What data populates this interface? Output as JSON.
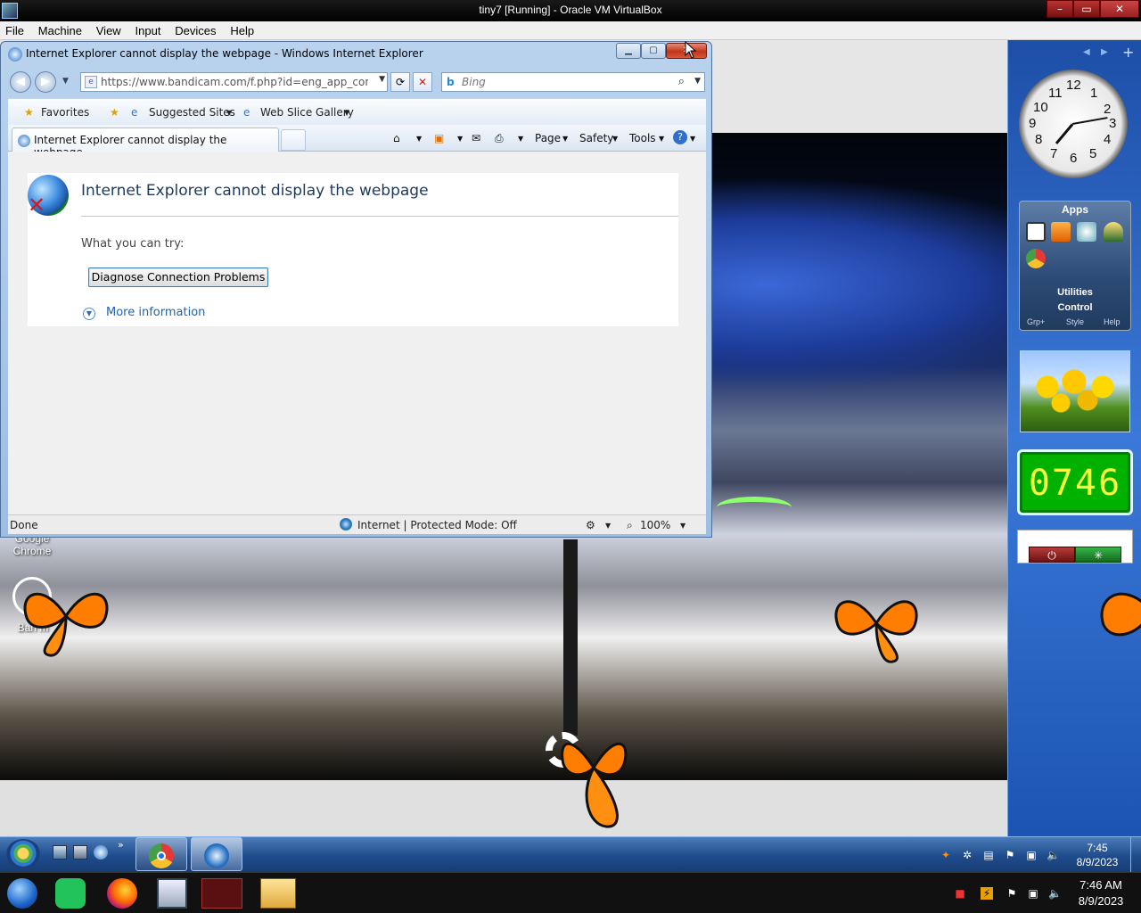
{
  "host": {
    "title": "tiny7 [Running] - Oracle VM VirtualBox",
    "menu": [
      "File",
      "Machine",
      "View",
      "Input",
      "Devices",
      "Help"
    ],
    "clock_time": "7:46 AM",
    "clock_date": "8/9/2023"
  },
  "ie": {
    "window_title": "Internet Explorer cannot display the webpage - Windows Internet Explorer",
    "address_value": "https://www.bandicam.com/f.php?id=eng_app_complet",
    "search_placeholder": "Bing",
    "favorites_label": "Favorites",
    "suggested_sites_label": "Suggested Sites",
    "web_slice_label": "Web Slice Gallery",
    "tab_title": "Internet Explorer cannot display the webpage",
    "commands": [
      "Page",
      "Safety",
      "Tools"
    ],
    "error_title": "Internet Explorer cannot display the webpage",
    "try_label": "What you can try:",
    "diagnose_button": "Diagnose Connection Problems",
    "more_info": "More information",
    "status_done": "Done",
    "status_zone": "Internet | Protected Mode: Off",
    "zoom": "100%"
  },
  "desktop": {
    "icon_chrome_label": "Google\nChrome",
    "icon_bandicam_label": "Ban     m"
  },
  "gadgets": {
    "apps_title": "Apps",
    "utilities_label": "Utilities",
    "control_label": "Control",
    "footer": [
      "Grp+",
      "Style",
      "Help"
    ],
    "digital_clock": "0746"
  },
  "guest_taskbar": {
    "clock_time": "7:45",
    "clock_date": "8/9/2023"
  },
  "icons": {
    "ie": "internet-explorer-icon",
    "chrome": "chrome-icon",
    "butterfly": "butterfly-icon"
  }
}
